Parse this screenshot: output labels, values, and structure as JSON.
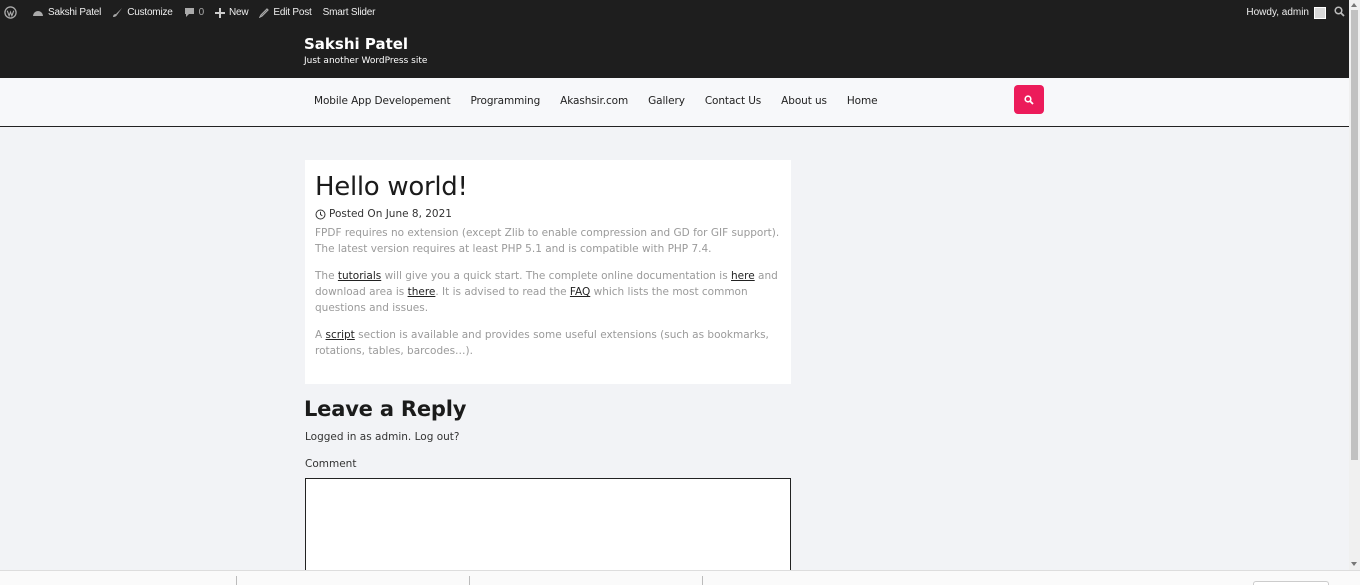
{
  "adminbar": {
    "site_name": "Sakshi Patel",
    "customize": "Customize",
    "comments_count": "0",
    "new": "New",
    "edit_post": "Edit Post",
    "smart_slider": "Smart Slider",
    "howdy": "Howdy, admin"
  },
  "header": {
    "title": "Sakshi Patel",
    "description": "Just another WordPress site"
  },
  "nav": {
    "items": [
      {
        "label": "Mobile App Developement"
      },
      {
        "label": "Programming"
      },
      {
        "label": "Akashsir.com"
      },
      {
        "label": "Gallery"
      },
      {
        "label": "Contact Us"
      },
      {
        "label": "About us"
      },
      {
        "label": "Home"
      }
    ]
  },
  "post": {
    "title": "Hello world!",
    "posted_on": "Posted On June 8, 2021",
    "p1": "FPDF requires no extension (except Zlib to enable compression and GD for GIF support). The latest version requires at least PHP 5.1 and is compatible with PHP 7.4.",
    "p2_a": "The ",
    "p2_link1": "tutorials",
    "p2_b": " will give you a quick start. The complete online documentation is ",
    "p2_link2": "here",
    "p2_c": " and download area is ",
    "p2_link3": "there",
    "p2_d": ". It is advised to read the ",
    "p2_link4": "FAQ",
    "p2_e": " which lists the most common questions and issues.",
    "p3_a": "A ",
    "p3_link": "script",
    "p3_b": " section is available and provides some useful extensions (such as bookmarks, rotations, tables, barcodes…)."
  },
  "comments": {
    "title": "Leave a Reply",
    "logged_in": "Logged in as admin. Log out?",
    "comment_label": "Comment"
  },
  "colors": {
    "accent": "#ec1b5a",
    "header_bg": "#1e1e1e",
    "page_bg": "#f2f3f6"
  }
}
